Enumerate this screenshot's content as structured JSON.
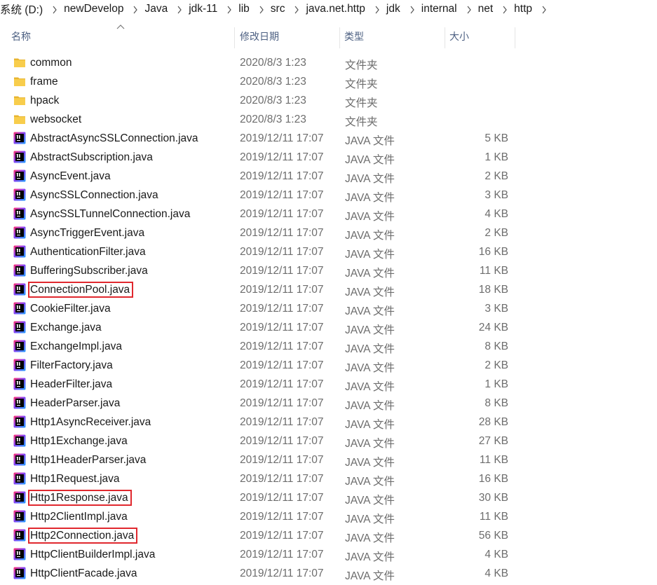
{
  "breadcrumb": [
    "系统 (D:)",
    "newDevelop",
    "Java",
    "jdk-11",
    "lib",
    "src",
    "java.net.http",
    "jdk",
    "internal",
    "net",
    "http"
  ],
  "columns": {
    "name": "名称",
    "date": "修改日期",
    "type": "类型",
    "size": "大小"
  },
  "colors": {
    "highlight": "#e0282e",
    "header_text": "#4d6082",
    "folder": "#f4c53e"
  },
  "rows": [
    {
      "icon": "folder-icon",
      "name": "common",
      "date": "2020/8/3 1:23",
      "type": "文件夹",
      "size": ""
    },
    {
      "icon": "folder-icon",
      "name": "frame",
      "date": "2020/8/3 1:23",
      "type": "文件夹",
      "size": ""
    },
    {
      "icon": "folder-icon",
      "name": "hpack",
      "date": "2020/8/3 1:23",
      "type": "文件夹",
      "size": ""
    },
    {
      "icon": "folder-icon",
      "name": "websocket",
      "date": "2020/8/3 1:23",
      "type": "文件夹",
      "size": ""
    },
    {
      "icon": "java-file-icon",
      "name": "AbstractAsyncSSLConnection.java",
      "date": "2019/12/11 17:07",
      "type": "JAVA 文件",
      "size": "5 KB"
    },
    {
      "icon": "java-file-icon",
      "name": "AbstractSubscription.java",
      "date": "2019/12/11 17:07",
      "type": "JAVA 文件",
      "size": "1 KB"
    },
    {
      "icon": "java-file-icon",
      "name": "AsyncEvent.java",
      "date": "2019/12/11 17:07",
      "type": "JAVA 文件",
      "size": "2 KB"
    },
    {
      "icon": "java-file-icon",
      "name": "AsyncSSLConnection.java",
      "date": "2019/12/11 17:07",
      "type": "JAVA 文件",
      "size": "3 KB"
    },
    {
      "icon": "java-file-icon",
      "name": "AsyncSSLTunnelConnection.java",
      "date": "2019/12/11 17:07",
      "type": "JAVA 文件",
      "size": "4 KB"
    },
    {
      "icon": "java-file-icon",
      "name": "AsyncTriggerEvent.java",
      "date": "2019/12/11 17:07",
      "type": "JAVA 文件",
      "size": "2 KB"
    },
    {
      "icon": "java-file-icon",
      "name": "AuthenticationFilter.java",
      "date": "2019/12/11 17:07",
      "type": "JAVA 文件",
      "size": "16 KB"
    },
    {
      "icon": "java-file-icon",
      "name": "BufferingSubscriber.java",
      "date": "2019/12/11 17:07",
      "type": "JAVA 文件",
      "size": "11 KB"
    },
    {
      "icon": "java-file-icon",
      "name": "ConnectionPool.java",
      "date": "2019/12/11 17:07",
      "type": "JAVA 文件",
      "size": "18 KB",
      "highlighted": true
    },
    {
      "icon": "java-file-icon",
      "name": "CookieFilter.java",
      "date": "2019/12/11 17:07",
      "type": "JAVA 文件",
      "size": "3 KB"
    },
    {
      "icon": "java-file-icon",
      "name": "Exchange.java",
      "date": "2019/12/11 17:07",
      "type": "JAVA 文件",
      "size": "24 KB"
    },
    {
      "icon": "java-file-icon",
      "name": "ExchangeImpl.java",
      "date": "2019/12/11 17:07",
      "type": "JAVA 文件",
      "size": "8 KB"
    },
    {
      "icon": "java-file-icon",
      "name": "FilterFactory.java",
      "date": "2019/12/11 17:07",
      "type": "JAVA 文件",
      "size": "2 KB"
    },
    {
      "icon": "java-file-icon",
      "name": "HeaderFilter.java",
      "date": "2019/12/11 17:07",
      "type": "JAVA 文件",
      "size": "1 KB"
    },
    {
      "icon": "java-file-icon",
      "name": "HeaderParser.java",
      "date": "2019/12/11 17:07",
      "type": "JAVA 文件",
      "size": "8 KB"
    },
    {
      "icon": "java-file-icon",
      "name": "Http1AsyncReceiver.java",
      "date": "2019/12/11 17:07",
      "type": "JAVA 文件",
      "size": "28 KB"
    },
    {
      "icon": "java-file-icon",
      "name": "Http1Exchange.java",
      "date": "2019/12/11 17:07",
      "type": "JAVA 文件",
      "size": "27 KB"
    },
    {
      "icon": "java-file-icon",
      "name": "Http1HeaderParser.java",
      "date": "2019/12/11 17:07",
      "type": "JAVA 文件",
      "size": "11 KB"
    },
    {
      "icon": "java-file-icon",
      "name": "Http1Request.java",
      "date": "2019/12/11 17:07",
      "type": "JAVA 文件",
      "size": "16 KB"
    },
    {
      "icon": "java-file-icon",
      "name": "Http1Response.java",
      "date": "2019/12/11 17:07",
      "type": "JAVA 文件",
      "size": "30 KB",
      "highlighted": true
    },
    {
      "icon": "java-file-icon",
      "name": "Http2ClientImpl.java",
      "date": "2019/12/11 17:07",
      "type": "JAVA 文件",
      "size": "11 KB"
    },
    {
      "icon": "java-file-icon",
      "name": "Http2Connection.java",
      "date": "2019/12/11 17:07",
      "type": "JAVA 文件",
      "size": "56 KB",
      "highlighted": true
    },
    {
      "icon": "java-file-icon",
      "name": "HttpClientBuilderImpl.java",
      "date": "2019/12/11 17:07",
      "type": "JAVA 文件",
      "size": "4 KB"
    },
    {
      "icon": "java-file-icon",
      "name": "HttpClientFacade.java",
      "date": "2019/12/11 17:07",
      "type": "JAVA 文件",
      "size": "4 KB"
    }
  ]
}
